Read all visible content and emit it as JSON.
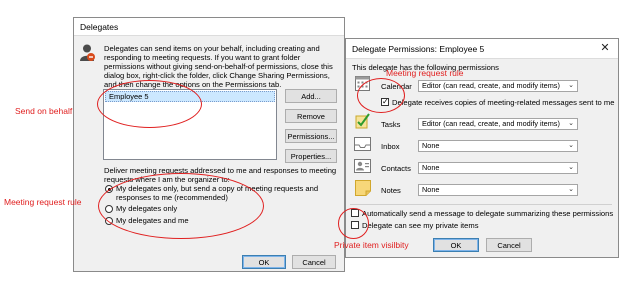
{
  "annotations": {
    "send_on_behalf": "Send on behalf",
    "meeting_request_rule_left": "Meeting request rule",
    "meeting_request_rule_top": "Meeting request rule",
    "private_item_visibility": "Private item visilbity",
    "color": "#e02020"
  },
  "delegates_dialog": {
    "title": "Delegates",
    "description": "Delegates can send items on your behalf, including creating and responding to meeting requests. If you want to grant folder permissions without giving send-on-behalf-of permissions, close this dialog box, right-click the folder, click Change Sharing Permissions, and then change the options on the Permissions tab.",
    "description_lines": [
      "Delegates can send items on your behalf, including creating and",
      "responding to meeting requests. If you want to grant folder",
      "permissions without giving send-on-behalf-of permissions, close this",
      "dialog box, right-click the folder, click Change Sharing Permissions,",
      "and then change the options on the Permissions tab."
    ],
    "delegates": [
      "Employee 5"
    ],
    "buttons": {
      "add": "Add...",
      "remove": "Remove",
      "permissions": "Permissions...",
      "properties": "Properties...",
      "ok": "OK",
      "cancel": "Cancel"
    },
    "deliver_label_lines": [
      "Deliver meeting requests addressed to me and responses to meeting",
      "requests where I am the organizer to:"
    ],
    "options": [
      {
        "label_lines": [
          "My delegates only, but send a copy of meeting requests and",
          "responses to me (recommended)"
        ],
        "selected": true
      },
      {
        "label_lines": [
          "My delegates only"
        ],
        "selected": false
      },
      {
        "label_lines": [
          "My delegates and me"
        ],
        "selected": false
      }
    ]
  },
  "permissions_dialog": {
    "title": "Delegate Permissions: Employee 5",
    "heading": "This delegate has the following permissions",
    "rows": [
      {
        "label": "Calendar",
        "value": "Editor (can read, create, and modify items)",
        "icon": "calendar-icon"
      },
      {
        "label": "Tasks",
        "value": "Editor (can read, create, and modify items)",
        "icon": "tasks-icon"
      },
      {
        "label": "Inbox",
        "value": "None",
        "icon": "inbox-icon"
      },
      {
        "label": "Contacts",
        "value": "None",
        "icon": "contacts-icon"
      },
      {
        "label": "Notes",
        "value": "None",
        "icon": "notes-icon"
      }
    ],
    "meeting_copies": {
      "label": "Delegate receives copies of meeting-related messages sent to me",
      "checked": true
    },
    "auto_summary": {
      "label": "Automatically send a message to delegate summarizing these permissions",
      "checked": false
    },
    "private_items": {
      "label": "Delegate can see my private items",
      "checked": false
    },
    "buttons": {
      "ok": "OK",
      "cancel": "Cancel"
    }
  }
}
